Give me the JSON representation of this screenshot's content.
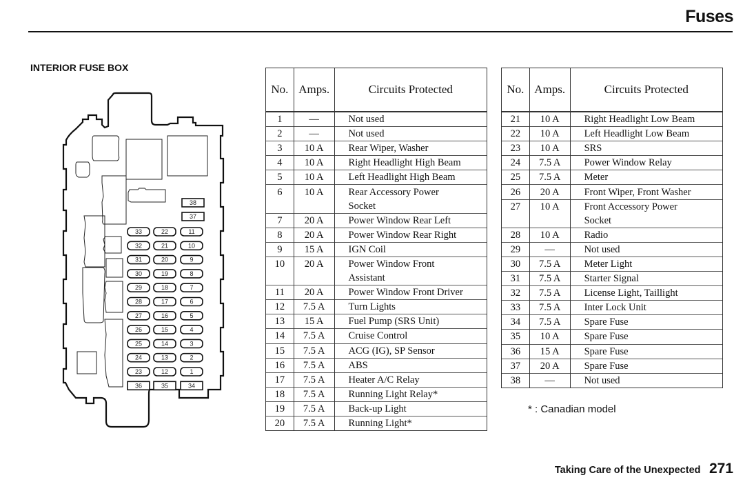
{
  "header": {
    "title": "Fuses"
  },
  "section": {
    "heading": "INTERIOR FUSE BOX"
  },
  "columns": {
    "no": "No.",
    "amps": "Amps.",
    "circuits": "Circuits Protected"
  },
  "fuses_left": [
    {
      "no": "1",
      "amps": "—",
      "circuit": "Not used"
    },
    {
      "no": "2",
      "amps": "—",
      "circuit": "Not used"
    },
    {
      "no": "3",
      "amps": "10 A",
      "circuit": "Rear Wiper, Washer"
    },
    {
      "no": "4",
      "amps": "10 A",
      "circuit": "Right Headlight High Beam"
    },
    {
      "no": "5",
      "amps": "10 A",
      "circuit": "Left Headlight High Beam"
    },
    {
      "no": "6",
      "amps": "10 A",
      "circuit": "Rear Accessory Power",
      "circuit_cont": "Socket"
    },
    {
      "no": "7",
      "amps": "20 A",
      "circuit": "Power Window Rear Left"
    },
    {
      "no": "8",
      "amps": "20 A",
      "circuit": "Power Window Rear Right"
    },
    {
      "no": "9",
      "amps": "15 A",
      "circuit": "IGN Coil"
    },
    {
      "no": "10",
      "amps": "20 A",
      "circuit": "Power Window Front",
      "circuit_cont": "Assistant"
    },
    {
      "no": "11",
      "amps": "20 A",
      "circuit": "Power Window Front Driver"
    },
    {
      "no": "12",
      "amps": "7.5 A",
      "circuit": "Turn Lights"
    },
    {
      "no": "13",
      "amps": "15 A",
      "circuit": "Fuel Pump (SRS Unit)"
    },
    {
      "no": "14",
      "amps": "7.5 A",
      "circuit": "Cruise Control"
    },
    {
      "no": "15",
      "amps": "7.5 A",
      "circuit": "ACG (IG), SP Sensor"
    },
    {
      "no": "16",
      "amps": "7.5 A",
      "circuit": "ABS"
    },
    {
      "no": "17",
      "amps": "7.5 A",
      "circuit": "Heater A/C Relay"
    },
    {
      "no": "18",
      "amps": "7.5 A",
      "circuit": "Running Light Relay*"
    },
    {
      "no": "19",
      "amps": "7.5 A",
      "circuit": "Back-up Light"
    },
    {
      "no": "20",
      "amps": "7.5 A",
      "circuit": "Running Light*"
    }
  ],
  "fuses_right": [
    {
      "no": "21",
      "amps": "10 A",
      "circuit": "Right Headlight Low Beam"
    },
    {
      "no": "22",
      "amps": "10 A",
      "circuit": "Left Headlight Low Beam"
    },
    {
      "no": "23",
      "amps": "10 A",
      "circuit": "SRS"
    },
    {
      "no": "24",
      "amps": "7.5 A",
      "circuit": "Power Window Relay"
    },
    {
      "no": "25",
      "amps": "7.5 A",
      "circuit": "Meter"
    },
    {
      "no": "26",
      "amps": "20 A",
      "circuit": "Front Wiper, Front Washer"
    },
    {
      "no": "27",
      "amps": "10 A",
      "circuit": "Front Accessory Power",
      "circuit_cont": "Socket"
    },
    {
      "no": "28",
      "amps": "10 A",
      "circuit": "Radio"
    },
    {
      "no": "29",
      "amps": "—",
      "circuit": "Not used"
    },
    {
      "no": "30",
      "amps": "7.5 A",
      "circuit": "Meter Light"
    },
    {
      "no": "31",
      "amps": "7.5 A",
      "circuit": "Starter Signal"
    },
    {
      "no": "32",
      "amps": "7.5 A",
      "circuit": "License Light, Taillight"
    },
    {
      "no": "33",
      "amps": "7.5 A",
      "circuit": "Inter Lock Unit"
    },
    {
      "no": "34",
      "amps": "7.5 A",
      "circuit": "Spare Fuse"
    },
    {
      "no": "35",
      "amps": "10 A",
      "circuit": "Spare Fuse"
    },
    {
      "no": "36",
      "amps": "15 A",
      "circuit": "Spare Fuse"
    },
    {
      "no": "37",
      "amps": "20 A",
      "circuit": "Spare Fuse"
    },
    {
      "no": "38",
      "amps": "—",
      "circuit": "Not used"
    }
  ],
  "diagram": {
    "grid_rows": [
      [
        "33",
        "22",
        "11"
      ],
      [
        "32",
        "21",
        "10"
      ],
      [
        "31",
        "20",
        "9"
      ],
      [
        "30",
        "19",
        "8"
      ],
      [
        "29",
        "18",
        "7"
      ],
      [
        "28",
        "17",
        "6"
      ],
      [
        "27",
        "16",
        "5"
      ],
      [
        "26",
        "15",
        "4"
      ],
      [
        "25",
        "14",
        "3"
      ],
      [
        "24",
        "13",
        "2"
      ],
      [
        "23",
        "12",
        "1"
      ]
    ],
    "spare_top": [
      "38",
      "37"
    ],
    "spare_bottom": [
      "36",
      "35",
      "34"
    ]
  },
  "footnote": "* : Canadian model",
  "footer": {
    "section": "Taking Care of the Unexpected",
    "page": "271"
  }
}
